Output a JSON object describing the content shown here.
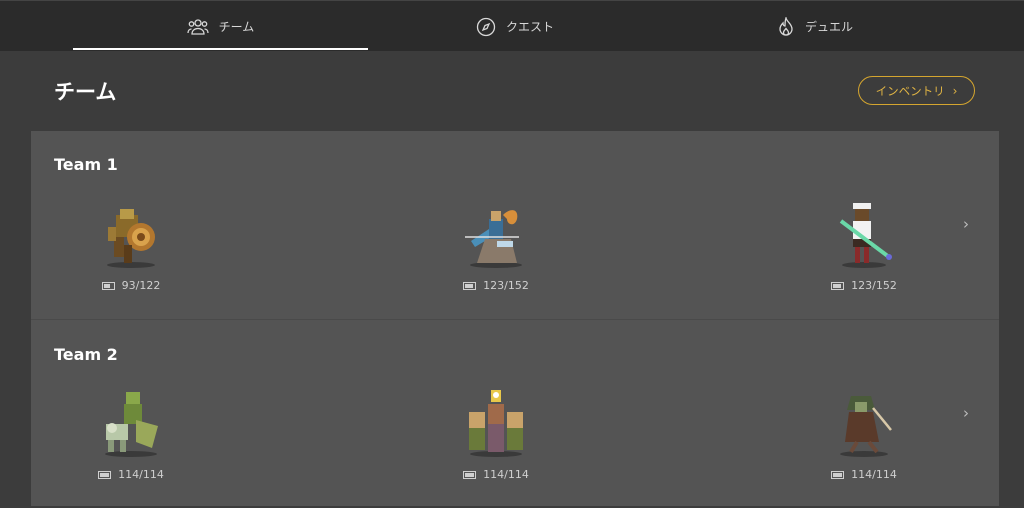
{
  "tabs": [
    {
      "label": "チーム",
      "icon": "people-icon",
      "active": true
    },
    {
      "label": "クエスト",
      "icon": "compass-icon",
      "active": false
    },
    {
      "label": "デュエル",
      "icon": "flame-icon",
      "active": false
    }
  ],
  "header": {
    "title": "チーム",
    "inventory_label": "インベントリ",
    "inventory_chevron": "›"
  },
  "teams": [
    {
      "name": "Team 1",
      "units": [
        {
          "sprite": "armored-warrior-with-shield",
          "stamina": "93/122"
        },
        {
          "sprite": "blue-mage-with-staff",
          "stamina": "123/152"
        },
        {
          "sprite": "green-gunner-girl",
          "stamina": "123/152"
        }
      ]
    },
    {
      "name": "Team 2",
      "units": [
        {
          "sprite": "orc-with-beast",
          "stamina": "114/114"
        },
        {
          "sprite": "trio-with-lantern",
          "stamina": "114/114"
        },
        {
          "sprite": "hooded-swordsman",
          "stamina": "114/114"
        }
      ]
    }
  ],
  "row_chevron": "›",
  "colors": {
    "accent": "#d4a52f",
    "panel": "#545454",
    "background": "#3c3c3c",
    "topbar": "#2b2b2b"
  }
}
